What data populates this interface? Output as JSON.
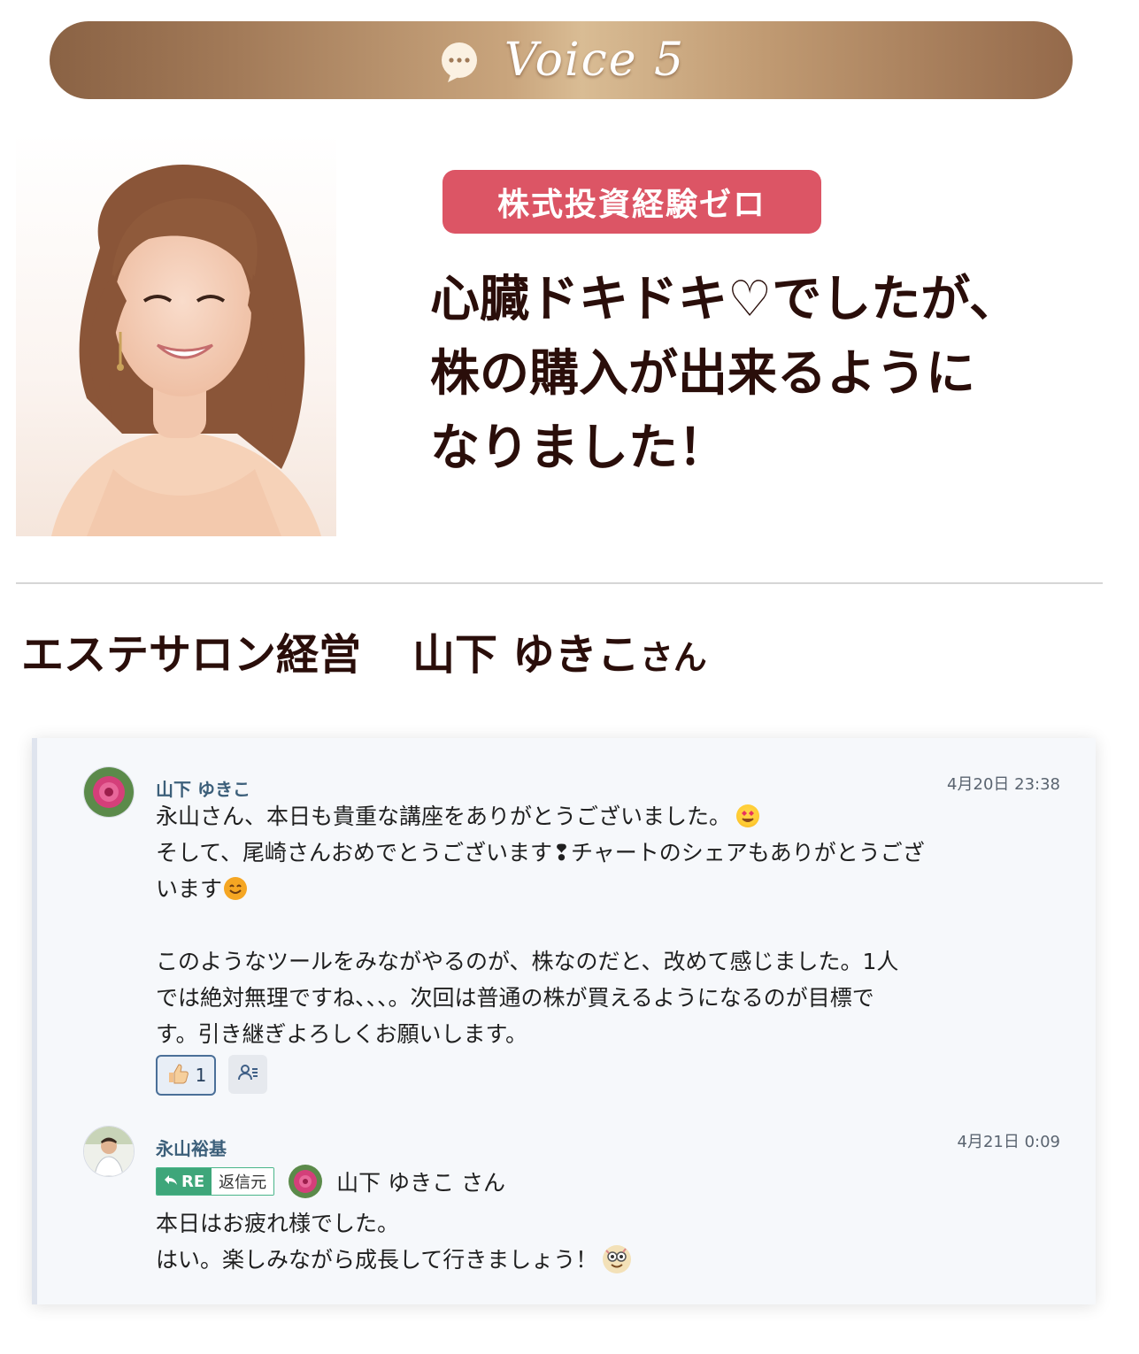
{
  "banner": {
    "title": "Voice 5",
    "icon": "speech-bubble-icon"
  },
  "profile": {
    "badge": "株式投資経験ゼロ",
    "headline": [
      "心臓ドキドキ♡でしたが、",
      "株の購入が出来るように",
      "なりました！"
    ],
    "occupation": "エステサロン経営",
    "name": "山下 ゆきこ",
    "honorific": "さん"
  },
  "chat": {
    "messages": [
      {
        "author": "山下 ゆきこ",
        "time": "4月20日 23:38",
        "lines": [
          "永山さん、本日も貴重な講座をありがとうございました。",
          "そして、尾崎さんおめでとうございます❢チャートのシェアもありがとうござ",
          "います",
          "",
          "このようなツールをみながやるのが、株なのだと、改めて感じました。1人",
          "では絶対無理ですね、、、。次回は普通の株が買えるようになるのが目標で",
          "す。引き継ぎよろしくお願いします。"
        ],
        "reaction": {
          "icon": "thumbs-up-icon",
          "count": "1"
        },
        "member_icon": "member-list-icon"
      },
      {
        "author": "永山裕基",
        "time": "4月21日 0:09",
        "reply": {
          "tag": "RE",
          "source_label": "返信元",
          "to": "山下 ゆきこ さん"
        },
        "lines": [
          "本日はお疲れ様でした。",
          "はい。楽しみながら成長して行きましょう！"
        ]
      }
    ]
  },
  "colors": {
    "badge": "#dc5565",
    "accent_text": "#2a0e0a",
    "banner_gold": "#c9a57d"
  }
}
